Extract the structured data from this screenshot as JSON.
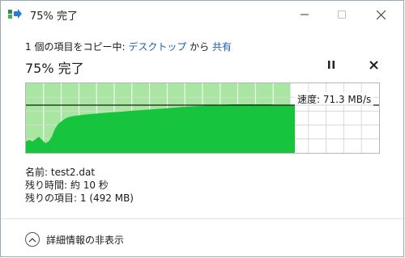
{
  "window": {
    "title": "75% 完了"
  },
  "header": {
    "copy_prefix": "1 個の項目をコピー中: ",
    "source": "デスクトップ",
    "connector": " から ",
    "destination": "共有"
  },
  "progress": {
    "title": "75% 完了",
    "percent": 75
  },
  "graph": {
    "speed_label": "速度: 71.3 MB/s",
    "fill_color": "#16c43d",
    "remaining_color": "#a8e6a1",
    "grid_color": "#ffffff"
  },
  "details": {
    "name_label": "名前:",
    "name_value": "test2.dat",
    "time_label": "残り時間:",
    "time_value": "約 10 秒",
    "items_label": "残りの項目:",
    "items_value": "1 (492 MB)"
  },
  "footer": {
    "toggle_label": "詳細情報の非表示"
  },
  "icons": {
    "app": "copy-arrow-icon",
    "minimize": "minimize-icon",
    "maximize": "maximize-icon",
    "close": "close-icon",
    "pause": "pause-icon",
    "cancel": "cancel-icon",
    "chevron": "chevron-up-icon"
  }
}
